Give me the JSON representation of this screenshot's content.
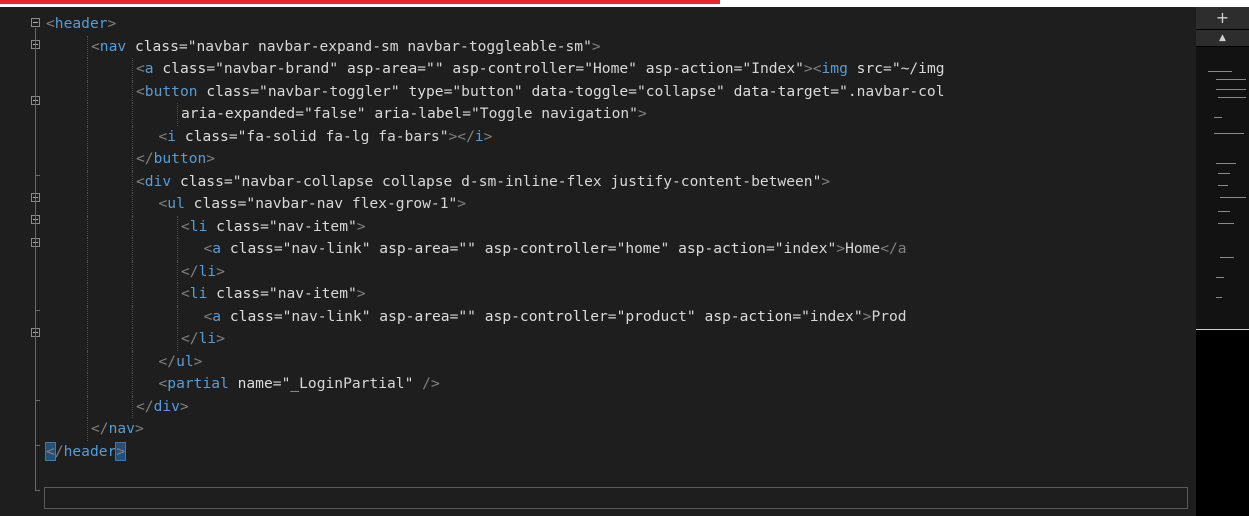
{
  "editor": {
    "lines": [
      {
        "indent": 0,
        "tokens": [
          [
            "bracket",
            "<"
          ],
          [
            "tag",
            "header"
          ],
          [
            "bracket",
            ">"
          ]
        ]
      },
      {
        "indent": 1,
        "tokens": [
          [
            "bracket",
            "<"
          ],
          [
            "tag",
            "nav"
          ],
          [
            "txt",
            " "
          ],
          [
            "attr",
            "class"
          ],
          [
            "eq",
            "="
          ],
          [
            "str",
            "\"navbar navbar-expand-sm navbar-toggleable-sm\""
          ],
          [
            "bracket",
            ">"
          ]
        ]
      },
      {
        "indent": 2,
        "tokens": [
          [
            "bracket",
            "<"
          ],
          [
            "tag",
            "a"
          ],
          [
            "txt",
            " "
          ],
          [
            "attr",
            "class"
          ],
          [
            "eq",
            "="
          ],
          [
            "str",
            "\"navbar-brand\""
          ],
          [
            "txt",
            " "
          ],
          [
            "attr",
            "asp-area"
          ],
          [
            "eq",
            "="
          ],
          [
            "str",
            "\"\""
          ],
          [
            "txt",
            " "
          ],
          [
            "attr",
            "asp-controller"
          ],
          [
            "eq",
            "="
          ],
          [
            "str",
            "\"Home\""
          ],
          [
            "txt",
            " "
          ],
          [
            "attr",
            "asp-action"
          ],
          [
            "eq",
            "="
          ],
          [
            "str",
            "\"Index\""
          ],
          [
            "bracket",
            "><"
          ],
          [
            "tag",
            "img"
          ],
          [
            "txt",
            " "
          ],
          [
            "attr",
            "src"
          ],
          [
            "eq",
            "="
          ],
          [
            "str",
            "\"~/img"
          ]
        ]
      },
      {
        "indent": 2,
        "tokens": [
          [
            "bracket",
            "<"
          ],
          [
            "tag",
            "button"
          ],
          [
            "txt",
            " "
          ],
          [
            "attr",
            "class"
          ],
          [
            "eq",
            "="
          ],
          [
            "str",
            "\"navbar-toggler\""
          ],
          [
            "txt",
            " "
          ],
          [
            "attr",
            "type"
          ],
          [
            "eq",
            "="
          ],
          [
            "str",
            "\"button\""
          ],
          [
            "txt",
            " "
          ],
          [
            "attr",
            "data-toggle"
          ],
          [
            "eq",
            "="
          ],
          [
            "str",
            "\"collapse\""
          ],
          [
            "txt",
            " "
          ],
          [
            "attr",
            "data-target"
          ],
          [
            "eq",
            "="
          ],
          [
            "str",
            "\".navbar-col"
          ]
        ]
      },
      {
        "indent": 3,
        "tokens": [
          [
            "attr",
            "aria-expanded"
          ],
          [
            "eq",
            "="
          ],
          [
            "str",
            "\"false\""
          ],
          [
            "txt",
            " "
          ],
          [
            "attr",
            "aria-label"
          ],
          [
            "eq",
            "="
          ],
          [
            "str",
            "\"Toggle navigation\""
          ],
          [
            "bracket",
            ">"
          ]
        ]
      },
      {
        "indent": 2.5,
        "tokens": [
          [
            "bracket",
            "<"
          ],
          [
            "tag",
            "i"
          ],
          [
            "txt",
            " "
          ],
          [
            "attr",
            "class"
          ],
          [
            "eq",
            "="
          ],
          [
            "str",
            "\"fa-solid fa-lg fa-bars\""
          ],
          [
            "bracket",
            "></"
          ],
          [
            "tag",
            "i"
          ],
          [
            "bracket",
            ">"
          ]
        ]
      },
      {
        "indent": 2,
        "tokens": [
          [
            "bracket",
            "</"
          ],
          [
            "tag",
            "button"
          ],
          [
            "bracket",
            ">"
          ]
        ]
      },
      {
        "indent": 2,
        "tokens": [
          [
            "bracket",
            "<"
          ],
          [
            "tag",
            "div"
          ],
          [
            "txt",
            " "
          ],
          [
            "attr",
            "class"
          ],
          [
            "eq",
            "="
          ],
          [
            "str",
            "\"navbar-collapse collapse d-sm-inline-flex justify-content-between\""
          ],
          [
            "bracket",
            ">"
          ]
        ]
      },
      {
        "indent": 2.5,
        "tokens": [
          [
            "bracket",
            "<"
          ],
          [
            "tag",
            "ul"
          ],
          [
            "txt",
            " "
          ],
          [
            "attr",
            "class"
          ],
          [
            "eq",
            "="
          ],
          [
            "str",
            "\"navbar-nav flex-grow-1\""
          ],
          [
            "bracket",
            ">"
          ]
        ]
      },
      {
        "indent": 3,
        "tokens": [
          [
            "bracket",
            "<"
          ],
          [
            "tag",
            "li"
          ],
          [
            "txt",
            " "
          ],
          [
            "attr",
            "class"
          ],
          [
            "eq",
            "="
          ],
          [
            "str",
            "\"nav-item\""
          ],
          [
            "bracket",
            ">"
          ]
        ]
      },
      {
        "indent": 3.5,
        "tokens": [
          [
            "bracket",
            "<"
          ],
          [
            "tag",
            "a"
          ],
          [
            "txt",
            " "
          ],
          [
            "attr",
            "class"
          ],
          [
            "eq",
            "="
          ],
          [
            "str",
            "\"nav-link\""
          ],
          [
            "txt",
            " "
          ],
          [
            "attr",
            "asp-area"
          ],
          [
            "eq",
            "="
          ],
          [
            "str",
            "\"\""
          ],
          [
            "txt",
            " "
          ],
          [
            "attr",
            "asp-controller"
          ],
          [
            "eq",
            "="
          ],
          [
            "str",
            "\"home\""
          ],
          [
            "txt",
            " "
          ],
          [
            "attr",
            "asp-action"
          ],
          [
            "eq",
            "="
          ],
          [
            "str",
            "\"index\""
          ],
          [
            "bracket",
            ">"
          ],
          [
            "txt",
            "Home"
          ],
          [
            "bracket",
            "</a"
          ]
        ]
      },
      {
        "indent": 3,
        "tokens": [
          [
            "bracket",
            "</"
          ],
          [
            "tag",
            "li"
          ],
          [
            "bracket",
            ">"
          ]
        ]
      },
      {
        "indent": 3,
        "tokens": [
          [
            "bracket",
            "<"
          ],
          [
            "tag",
            "li"
          ],
          [
            "txt",
            " "
          ],
          [
            "attr",
            "class"
          ],
          [
            "eq",
            "="
          ],
          [
            "str",
            "\"nav-item\""
          ],
          [
            "bracket",
            ">"
          ]
        ]
      },
      {
        "indent": 3.5,
        "tokens": [
          [
            "bracket",
            "<"
          ],
          [
            "tag",
            "a"
          ],
          [
            "txt",
            " "
          ],
          [
            "attr",
            "class"
          ],
          [
            "eq",
            "="
          ],
          [
            "str",
            "\"nav-link\""
          ],
          [
            "txt",
            " "
          ],
          [
            "attr",
            "asp-area"
          ],
          [
            "eq",
            "="
          ],
          [
            "str",
            "\"\""
          ],
          [
            "txt",
            " "
          ],
          [
            "attr",
            "asp-controller"
          ],
          [
            "eq",
            "="
          ],
          [
            "str",
            "\"product\""
          ],
          [
            "txt",
            " "
          ],
          [
            "attr",
            "asp-action"
          ],
          [
            "eq",
            "="
          ],
          [
            "str",
            "\"index\""
          ],
          [
            "bracket",
            ">"
          ],
          [
            "txt",
            "Prod"
          ]
        ]
      },
      {
        "indent": 3,
        "tokens": [
          [
            "bracket",
            "</"
          ],
          [
            "tag",
            "li"
          ],
          [
            "bracket",
            ">"
          ]
        ]
      },
      {
        "indent": 2.5,
        "tokens": [
          [
            "bracket",
            "</"
          ],
          [
            "tag",
            "ul"
          ],
          [
            "bracket",
            ">"
          ]
        ]
      },
      {
        "indent": 2.5,
        "tokens": [
          [
            "bracket",
            "<"
          ],
          [
            "tag",
            "partial"
          ],
          [
            "txt",
            " "
          ],
          [
            "attr",
            "name"
          ],
          [
            "eq",
            "="
          ],
          [
            "str",
            "\"_LoginPartial\""
          ],
          [
            "txt",
            " "
          ],
          [
            "bracket",
            "/>"
          ]
        ]
      },
      {
        "indent": 2,
        "tokens": [
          [
            "bracket",
            "</"
          ],
          [
            "tag",
            "div"
          ],
          [
            "bracket",
            ">"
          ]
        ]
      },
      {
        "indent": 1,
        "tokens": [
          [
            "bracket",
            "</"
          ],
          [
            "tag",
            "nav"
          ],
          [
            "bracket",
            ">"
          ]
        ]
      },
      {
        "indent": 0,
        "tokens": [
          [
            "bracket match",
            "<"
          ],
          [
            "bracket",
            "/"
          ],
          [
            "tag",
            "header"
          ],
          [
            "bracket match",
            ">"
          ]
        ]
      }
    ]
  },
  "scrollbar": {
    "add_glyph": "+",
    "up_glyph": "▲"
  },
  "colors": {
    "tag": "#569cd6",
    "bracket": "#808080",
    "background": "#1e1e1e",
    "accent_bar": "#e8262b"
  }
}
